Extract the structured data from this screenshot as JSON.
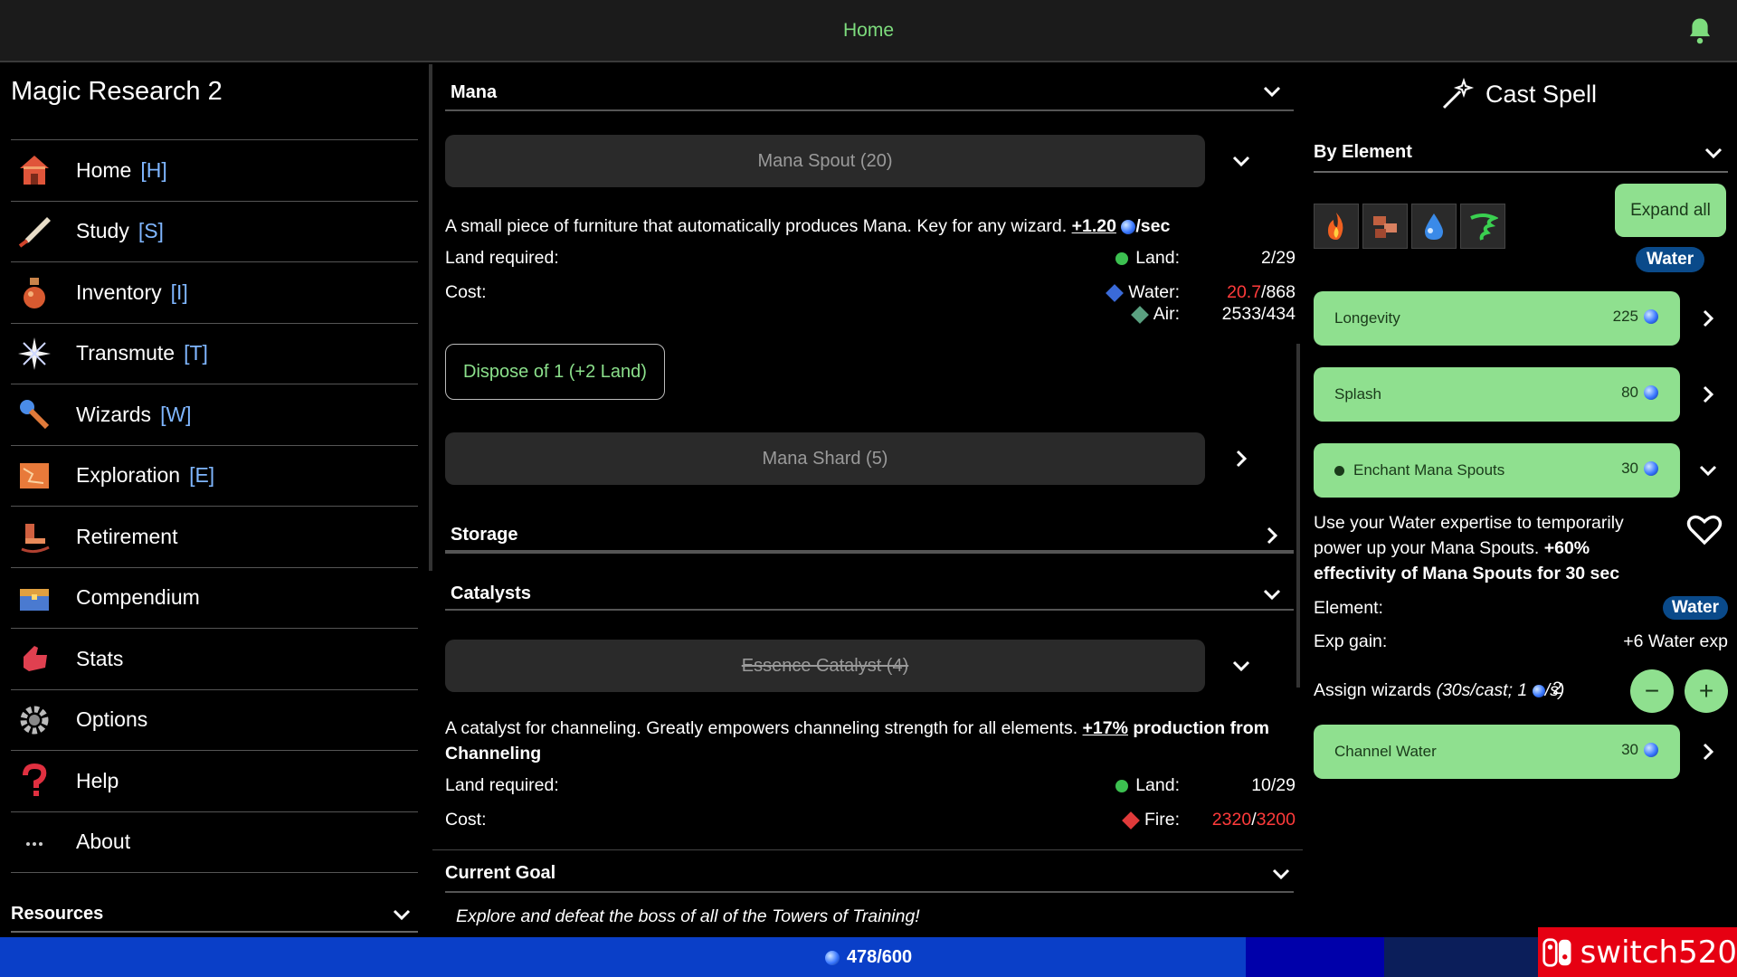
{
  "topbar": {
    "home": "Home",
    "bell_icon": "bell-icon"
  },
  "sidebar": {
    "title": "Magic Research 2",
    "items": [
      {
        "label": "Home",
        "key": "[H]",
        "icon": "house-icon"
      },
      {
        "label": "Study",
        "key": "[S]",
        "icon": "quill-icon"
      },
      {
        "label": "Inventory",
        "key": "[I]",
        "icon": "potion-icon"
      },
      {
        "label": "Transmute",
        "key": "[T]",
        "icon": "sparkle-icon"
      },
      {
        "label": "Wizards",
        "key": "[W]",
        "icon": "wand-icon"
      },
      {
        "label": "Exploration",
        "key": "[E]",
        "icon": "map-icon"
      },
      {
        "label": "Retirement",
        "key": "",
        "icon": "rocking-chair-icon"
      },
      {
        "label": "Compendium",
        "key": "",
        "icon": "chest-icon"
      },
      {
        "label": "Stats",
        "key": "",
        "icon": "thumbs-icon"
      },
      {
        "label": "Options",
        "key": "",
        "icon": "gear-icon"
      },
      {
        "label": "Help",
        "key": "",
        "icon": "question-icon"
      },
      {
        "label": "About",
        "key": "",
        "icon": "ellipsis-icon"
      }
    ],
    "resources": "Resources"
  },
  "middle": {
    "mana": {
      "header": "Mana",
      "spout_button": "Mana Spout (20)",
      "spout_desc": "A small piece of furniture that automatically produces Mana. Key for any wizard.",
      "spout_rate": "+1.20",
      "spout_rate_unit": "/sec",
      "land_required_label": "Land required:",
      "land_label": "Land:",
      "land_value": "2/29",
      "cost_label": "Cost:",
      "water_label": "Water:",
      "water_have": "20.7",
      "water_need": "/868",
      "air_label": "Air:",
      "air_value": "2533/434",
      "dispose_button": "Dispose of 1 (+2 Land)",
      "shard_button": "Mana Shard (5)"
    },
    "storage": {
      "header": "Storage"
    },
    "catalysts": {
      "header": "Catalysts",
      "button": "Essence Catalyst (4)",
      "desc": "A catalyst for channeling. Greatly empowers channeling strength for all elements.",
      "bonus": "+17%",
      "bonus_text": "production from Channeling",
      "land_required_label": "Land required:",
      "land_label": "Land:",
      "land_value": "10/29",
      "cost_label": "Cost:",
      "fire_label": "Fire:",
      "fire_have": "2320",
      "fire_sep": "/",
      "fire_need": "3200"
    },
    "goal": {
      "header": "Current Goal",
      "text": "Explore and defeat the boss of all of the Towers of Training!"
    }
  },
  "right": {
    "cast_title": "Cast Spell",
    "by_element": "By Element",
    "expand_all": "Expand all",
    "element_badge": "Water",
    "element_icons": [
      "fire-icon",
      "earth-icon",
      "water-icon",
      "air-icon"
    ],
    "spells": [
      {
        "name": "Longevity",
        "cost": "225"
      },
      {
        "name": "Splash",
        "cost": "80"
      },
      {
        "name": "Enchant Mana Spouts",
        "cost": "30"
      },
      {
        "name": "Channel Water",
        "cost": "30"
      }
    ],
    "detail": {
      "desc": "Use your Water expertise to temporarily power up your Mana Spouts.",
      "bold": "+60% effectivity of Mana Spouts for 30 sec",
      "element_label": "Element:",
      "element_value": "Water",
      "exp_label": "Exp gain:",
      "exp_value": "+6 Water exp",
      "assign_label": "Assign wizards",
      "assign_hint": "(30s/cast; 1",
      "assign_hint_unit": "/s)",
      "assign_count": "2",
      "minus": "−",
      "plus": "+"
    }
  },
  "bottombar": {
    "mana": "478/600",
    "mana_fraction": 0.797
  },
  "watermark": {
    "text": "switch520"
  },
  "colors": {
    "accent_green": "#8fe08f",
    "link_green": "#7ddc7d",
    "water_blue": "#0a4a8a",
    "warn_red": "#ff3b3b"
  }
}
